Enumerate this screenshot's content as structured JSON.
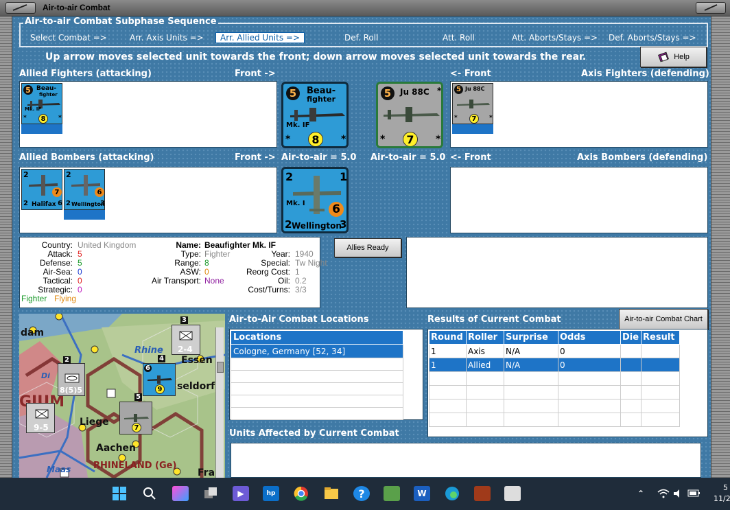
{
  "window": {
    "title": "Air-to-air Combat"
  },
  "subphase": {
    "legend": "Air-to-air Combat Subphase Sequence",
    "steps": [
      "Select Combat =>",
      "Arr. Axis Units =>",
      "Arr. Allied Units =>",
      "Def. Roll",
      "Att. Roll",
      "Att. Aborts/Stays =>",
      "Def. Aborts/Stays =>"
    ],
    "active_index": 2
  },
  "instruction": "Up arrow moves selected unit towards the front; down arrow moves selected unit towards the rear.",
  "help_button": "Help",
  "labels": {
    "allied_fighters": "Allied Fighters (attacking)",
    "front_right": "Front ->",
    "front_left": "<- Front",
    "axis_fighters": "Axis Fighters (defending)",
    "allied_bombers": "Allied Bombers (attacking)",
    "axis_bombers": "Axis Bombers (defending)",
    "air_to_air_allied": "Air-to-air = 5.0",
    "air_to_air_axis": "Air-to-air = 5.0"
  },
  "counters": {
    "beaufighter": {
      "top": "5",
      "name1": "Beau-",
      "name2": "fighter",
      "mark": "Mk. IF",
      "value": "8"
    },
    "ju88c": {
      "top": "5",
      "name": "Ju 88C",
      "value": "7"
    },
    "halifax": {
      "name": "Halifax",
      "left": "2",
      "right": "6",
      "value": "7"
    },
    "wellington": {
      "name": "Wellington",
      "left": "2",
      "right": "3",
      "mark": "Mk. I",
      "value": "6",
      "top_left": "2",
      "top_right": "1"
    },
    "star": "*"
  },
  "allies_ready_button": "Allies Ready",
  "unit_info": {
    "country_k": "Country:",
    "country_v": "United Kingdom",
    "attack_k": "Attack:",
    "attack_v": "5",
    "defense_k": "Defense:",
    "defense_v": "5",
    "airsea_k": "Air-Sea:",
    "airsea_v": "0",
    "tactical_k": "Tactical:",
    "tactical_v": "0",
    "strategic_k": "Strategic:",
    "strategic_v": "0",
    "fighter_tag": "Fighter",
    "flying_tag": "Flying",
    "name_k": "Name:",
    "name_v": "Beaufighter Mk. IF",
    "type_k": "Type:",
    "type_v": "Fighter",
    "range_k": "Range:",
    "range_v": "8",
    "asw_k": "ASW:",
    "asw_v": "0",
    "airtransport_k": "Air Transport:",
    "airtransport_v": "None",
    "year_k": "Year:",
    "year_v": "1940",
    "special_k": "Special:",
    "special_v": "Tw Night",
    "reorg_k": "Reorg Cost:",
    "reorg_v": "1",
    "oil_k": "Oil:",
    "oil_v": "0.2",
    "cost_k": "Cost/Turns:",
    "cost_v": "3/3",
    "colors": {
      "attack": "#e02020",
      "defense": "#1a9a2a",
      "airsea": "#1a3ad0",
      "tactical": "#e02020",
      "strategic": "#c020c0",
      "fighter": "#1a9a2a",
      "flying": "#e08a10",
      "range": "#1a9a2a",
      "asw": "#e08a10",
      "none": "#9020a0"
    }
  },
  "map": {
    "labels": {
      "dam": "dam",
      "essen": "Essen",
      "rhine": "Rhine",
      "dusseldorf": "seldorf",
      "liege": "Liege",
      "aachen": "Aachen",
      "rhineland": "RHINELAND (Ge)",
      "maas": "Maas",
      "gium": "GIUM",
      "fra": "Fra",
      "di": "Di"
    },
    "units": {
      "u1": "2-4",
      "u2": "8(5)5",
      "u3": "9-5",
      "u1n": "3",
      "u2n": "2",
      "u4n": "4",
      "u5n": "6",
      "u6n": "5",
      "mosq_val": "9",
      "ju_val": "7"
    }
  },
  "locations": {
    "title": "Air-to-Air Combat Locations",
    "header": "Locations",
    "rows": [
      "Cologne, Germany [52, 34]",
      "",
      "",
      "",
      "",
      ""
    ]
  },
  "results": {
    "title": "Results of Current Combat",
    "chart_button": "Air-to-air Combat Chart",
    "columns": [
      "Round",
      "Roller",
      "Surprise",
      "Odds",
      "Die",
      "Result"
    ],
    "rows": [
      [
        "1",
        "Axis",
        "N/A",
        "0",
        "",
        ""
      ],
      [
        "1",
        "Allied",
        "N/A",
        "0",
        "",
        ""
      ],
      [
        "",
        "",
        "",
        "",
        "",
        ""
      ],
      [
        "",
        "",
        "",
        "",
        "",
        ""
      ],
      [
        "",
        "",
        "",
        "",
        "",
        ""
      ],
      [
        "",
        "",
        "",
        "",
        "",
        ""
      ]
    ]
  },
  "affected": {
    "title": "Units Affected by Current Combat"
  },
  "taskbar": {
    "clock_line1": "5",
    "clock_line2": "11/2"
  }
}
